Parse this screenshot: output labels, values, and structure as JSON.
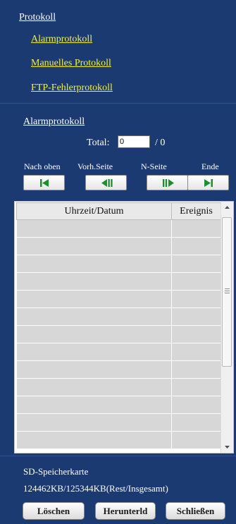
{
  "menu": {
    "protokoll_link": "Protokoll",
    "items": [
      {
        "label": "Alarmprotokoll"
      },
      {
        "label": "Manuelles Protokoll"
      },
      {
        "label": "FTP-Fehlerprotokoll"
      }
    ]
  },
  "log_section": {
    "title": "Alarmprotokoll",
    "total_label": "Total:",
    "total_value": "0",
    "total_of": "/ 0"
  },
  "navigation": {
    "labels": [
      "Nach oben",
      "Vorh.Seite",
      "N-Seite",
      "Ende"
    ],
    "icons": [
      "first-page-icon",
      "previous-page-icon",
      "next-page-icon",
      "last-page-icon"
    ],
    "icon_color": "#1e8f2e"
  },
  "table": {
    "columns": [
      "Uhrzeit/Datum",
      "Ereignis"
    ],
    "rows": []
  },
  "sd_card": {
    "title": "SD-Speicherkarte",
    "usage": "124462KB/125344KB(Rest/Insgesamt)"
  },
  "buttons": {
    "delete": "Löschen",
    "download": "Herunterld",
    "close": "Schließen"
  }
}
